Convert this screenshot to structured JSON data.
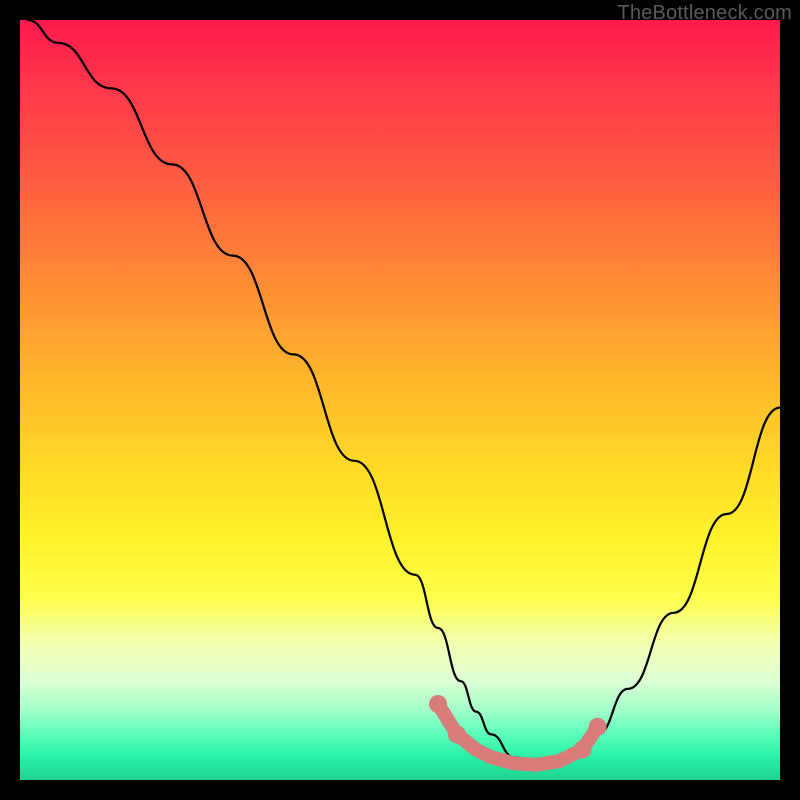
{
  "watermark": "TheBottleneck.com",
  "chart_data": {
    "type": "line",
    "title": "",
    "xlabel": "",
    "ylabel": "",
    "xlim": [
      0,
      100
    ],
    "ylim": [
      0,
      100
    ],
    "series": [
      {
        "name": "bottleneck-curve",
        "x": [
          1,
          5,
          12,
          20,
          28,
          36,
          44,
          52,
          55,
          58,
          60,
          62,
          65,
          68,
          71,
          73,
          76,
          80,
          86,
          93,
          100
        ],
        "y": [
          100,
          97,
          91,
          81,
          69,
          56,
          42,
          27,
          20,
          13,
          9,
          6,
          3,
          2,
          2,
          3,
          6,
          12,
          22,
          35,
          49
        ]
      }
    ],
    "highlight": {
      "name": "optimal-zone",
      "color": "#d77b7b",
      "points_x": [
        55,
        57.5,
        60,
        62,
        65,
        68,
        71,
        74,
        76
      ],
      "points_y": [
        10,
        6,
        4,
        3,
        2.2,
        2,
        2.5,
        4,
        7
      ]
    }
  }
}
